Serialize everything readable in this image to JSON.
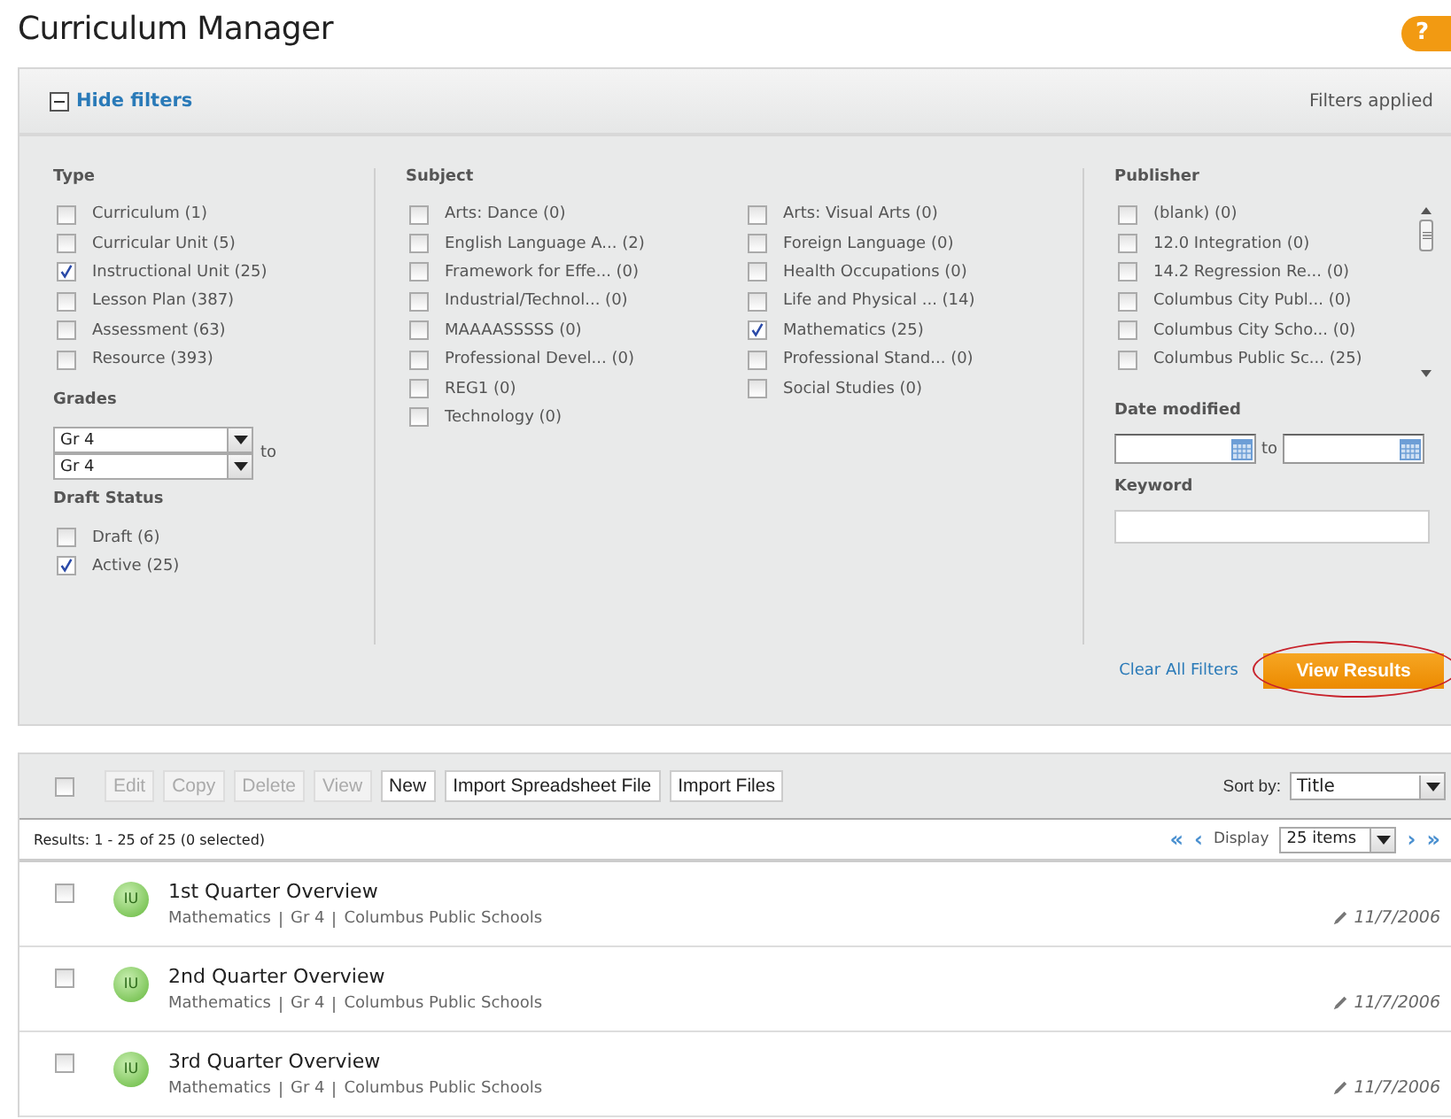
{
  "title": "Curriculum Manager",
  "help_label": "?",
  "filters": {
    "toggle_label": "Hide filters",
    "expanded": true,
    "status": "Filters applied",
    "type": {
      "label": "Type",
      "items": [
        {
          "label": "Curriculum (1)",
          "checked": false
        },
        {
          "label": "Curricular Unit (5)",
          "checked": false
        },
        {
          "label": "Instructional Unit (25)",
          "checked": true
        },
        {
          "label": "Lesson Plan (387)",
          "checked": false
        },
        {
          "label": "Assessment (63)",
          "checked": false
        },
        {
          "label": "Resource (393)",
          "checked": false
        }
      ]
    },
    "grades": {
      "label": "Grades",
      "from": "Gr 4",
      "to_label": "to",
      "to": "Gr 4"
    },
    "draft_status": {
      "label": "Draft Status",
      "items": [
        {
          "label": "Draft (6)",
          "checked": false
        },
        {
          "label": "Active (25)",
          "checked": true
        }
      ]
    },
    "subject": {
      "label": "Subject",
      "columns": [
        [
          {
            "label": "Arts: Dance (0)",
            "checked": false
          },
          {
            "label": "English Language A... (2)",
            "checked": false
          },
          {
            "label": "Framework for Effe... (0)",
            "checked": false
          },
          {
            "label": "Industrial/Technol... (0)",
            "checked": false
          },
          {
            "label": "MAAAASSSSS (0)",
            "checked": false
          },
          {
            "label": "Professional Devel... (0)",
            "checked": false
          },
          {
            "label": "REG1 (0)",
            "checked": false
          },
          {
            "label": "Technology (0)",
            "checked": false
          }
        ],
        [
          {
            "label": "Arts: Visual Arts (0)",
            "checked": false
          },
          {
            "label": "Foreign Language (0)",
            "checked": false
          },
          {
            "label": "Health Occupations (0)",
            "checked": false
          },
          {
            "label": "Life and Physical ... (14)",
            "checked": false
          },
          {
            "label": "Mathematics (25)",
            "checked": true
          },
          {
            "label": "Professional Stand... (0)",
            "checked": false
          },
          {
            "label": "Social Studies (0)",
            "checked": false
          }
        ]
      ]
    },
    "publisher": {
      "label": "Publisher",
      "items": [
        {
          "label": "(blank) (0)",
          "checked": false
        },
        {
          "label": "12.0 Integration (0)",
          "checked": false
        },
        {
          "label": "14.2 Regression Re... (0)",
          "checked": false
        },
        {
          "label": "Columbus City Publ... (0)",
          "checked": false
        },
        {
          "label": "Columbus City Scho... (0)",
          "checked": false
        },
        {
          "label": "Columbus Public Sc... (25)",
          "checked": false
        }
      ]
    },
    "date_modified": {
      "label": "Date modified",
      "to_label": "to"
    },
    "keyword": {
      "label": "Keyword"
    },
    "clear_label": "Clear All Filters",
    "view_results": {
      "label": "View Results",
      "highlighted": true
    }
  },
  "toolbar": {
    "select_all_checked": false,
    "buttons": [
      {
        "label": "Edit",
        "disabled": true
      },
      {
        "label": "Copy",
        "disabled": true
      },
      {
        "label": "Delete",
        "disabled": true
      },
      {
        "label": "View",
        "disabled": true
      },
      {
        "label": "New",
        "disabled": false
      },
      {
        "label": "Import Spreadsheet File",
        "disabled": false
      },
      {
        "label": "Import Files",
        "disabled": false
      }
    ],
    "sort_label": "Sort by:",
    "sort_value": "Title"
  },
  "results": {
    "summary": "Results: 1 - 25 of 25 (0 selected)",
    "first": "«",
    "prev": "‹",
    "display_label": "Display",
    "display_value": "25 items",
    "next": "›",
    "last": "»"
  },
  "rows": [
    {
      "title": "1st Quarter Overview",
      "badge": "IU",
      "subject": "Mathematics",
      "grade": "Gr 4",
      "publisher": "Columbus Public Schools",
      "date": "11/7/2006",
      "checked": false
    },
    {
      "title": "2nd Quarter Overview",
      "badge": "IU",
      "subject": "Mathematics",
      "grade": "Gr 4",
      "publisher": "Columbus Public Schools",
      "date": "11/7/2006",
      "checked": false
    },
    {
      "title": "3rd Quarter Overview",
      "badge": "IU",
      "subject": "Mathematics",
      "grade": "Gr 4",
      "publisher": "Columbus Public Schools",
      "date": "11/7/2006",
      "checked": false
    }
  ]
}
